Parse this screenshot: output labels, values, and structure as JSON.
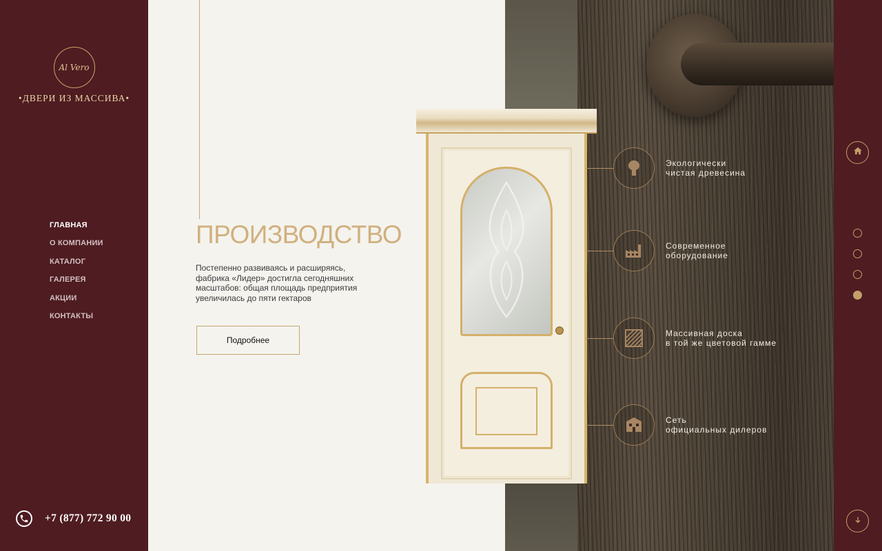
{
  "brand": {
    "logo_mark": "Al Vero",
    "tagline": "•ДВЕРИ ИЗ МАССИВА•"
  },
  "nav": [
    {
      "label": "ГЛАВНАЯ",
      "active": true
    },
    {
      "label": "О КОМПАНИИ"
    },
    {
      "label": "КАТАЛОГ"
    },
    {
      "label": "ГАЛЕРЕЯ"
    },
    {
      "label": "АКЦИИ"
    },
    {
      "label": "КОНТАКТЫ"
    }
  ],
  "contact": {
    "phone": "+7 (877) 772 90 00",
    "icon": "phone-icon"
  },
  "section": {
    "title": "ПРОИЗВОДСТВО",
    "description": "Постепенно развиваясь и расширяясь, фабрика «Лидер» достигла сегодняшних масштабов: общая площадь предприятия увеличилась до пяти гектаров",
    "button_label": "Подробнее"
  },
  "features": [
    {
      "icon": "tree-icon",
      "line1": "Экологически",
      "line2": "чистая древесина"
    },
    {
      "icon": "factory-icon",
      "line1": "Современное",
      "line2": "оборудование"
    },
    {
      "icon": "wood-board-icon",
      "line1": "Массивная доска",
      "line2": "в той же цветовой гамме"
    },
    {
      "icon": "store-icon",
      "line1": "Сеть",
      "line2": "официальных дилеров"
    }
  ],
  "right_rail": {
    "home_icon": "home-icon",
    "scroll_icon": "arrow-down-icon",
    "slides_total": 4,
    "slide_active": 4
  },
  "colors": {
    "sidebar": "#4e1c21",
    "accent_gold": "#c9a572",
    "title_gold": "#d1b07e",
    "content_bg": "#f4f3ee"
  }
}
